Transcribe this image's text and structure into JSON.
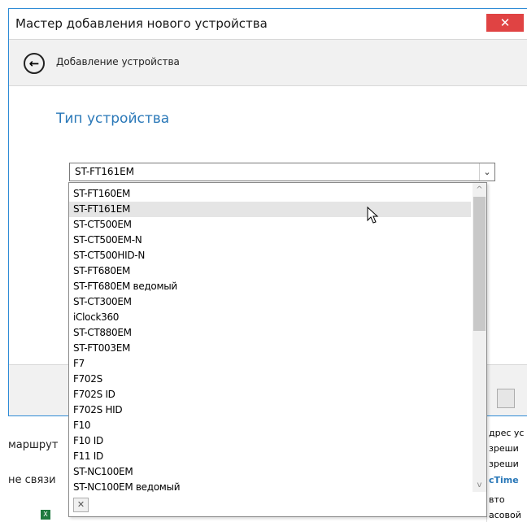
{
  "window": {
    "title": "Мастер добавления нового устройства",
    "close_icon": "close-icon"
  },
  "nav": {
    "title": "Добавление устройства",
    "back_icon": "back-arrow-icon"
  },
  "section_heading": "Тип устройства",
  "combo": {
    "value": "ST-FT161EM",
    "arrow_glyph": "⌄"
  },
  "dropdown": {
    "selected_index": 1,
    "items": [
      "ST-FT160EM",
      "ST-FT161EM",
      "ST-CT500EM",
      "ST-CT500EM-N",
      "ST-CT500HID-N",
      "ST-FT680EM",
      "ST-FT680EM ведомый",
      "ST-CT300EM",
      "iClock360",
      "ST-CT880EM",
      "ST-FT003EM",
      "F7",
      "F702S",
      "F702S ID",
      "F702S HID",
      "F10",
      "F10 ID",
      "F11 ID",
      "ST-NC100EM",
      "ST-NC100EM ведомый"
    ],
    "clear_glyph": "✕"
  },
  "background": {
    "left_labels": [
      "маршрут",
      "не связи"
    ],
    "right_cells": [
      "дрес ус",
      "зреши",
      "зреши",
      "cTime",
      "вто",
      "асовой"
    ]
  }
}
